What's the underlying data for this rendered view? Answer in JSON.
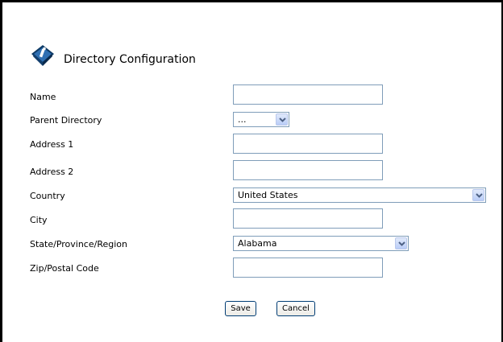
{
  "page": {
    "title": "Directory Configuration"
  },
  "form": {
    "fields": [
      {
        "label": "Name",
        "value": ""
      },
      {
        "label": "Parent Directory",
        "value": "..."
      },
      {
        "label": "Address 1",
        "value": ""
      },
      {
        "label": "Address 2",
        "value": ""
      },
      {
        "label": "Country",
        "value": "United States"
      },
      {
        "label": "City",
        "value": ""
      },
      {
        "label": "State/Province/Region",
        "value": "Alabama"
      },
      {
        "label": "Zip/Postal Code",
        "value": ""
      }
    ]
  },
  "buttons": {
    "save": "Save",
    "cancel": "Cancel"
  },
  "icons": {
    "logo": "directory-book-icon",
    "dropdown": "chevron-down-icon"
  },
  "colors": {
    "logo": "#1a4a7a",
    "input_border": "#7f9db9",
    "button_border": "#003c74"
  }
}
